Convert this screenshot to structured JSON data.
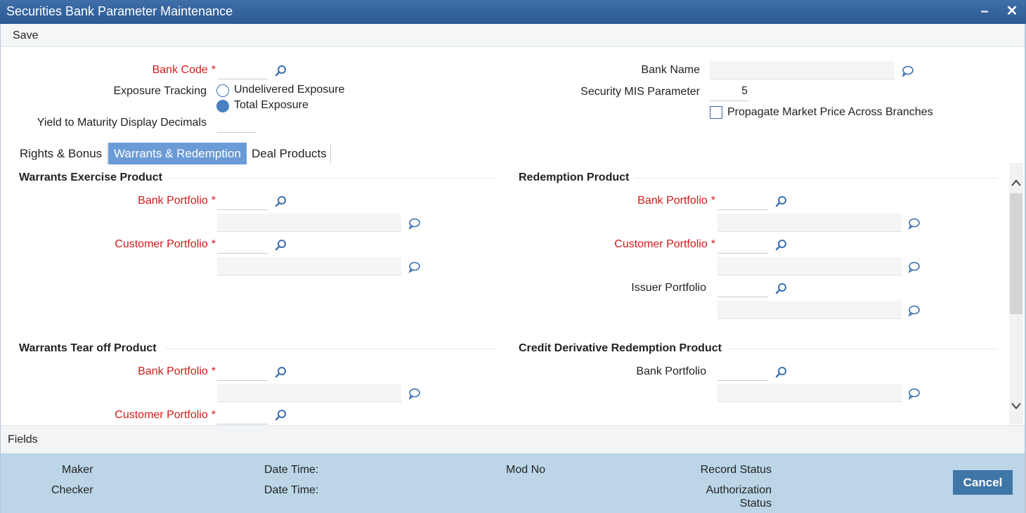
{
  "window": {
    "title": "Securities Bank Parameter Maintenance",
    "minimize_label": "–",
    "close_label": "✕"
  },
  "toolbar": {
    "save_label": "Save"
  },
  "header": {
    "bank_code_label": "Bank Code",
    "required_mark": "*",
    "bank_code_value": "",
    "exposure_tracking_label": "Exposure Tracking",
    "exposure_options": [
      "Undelivered Exposure",
      "Total Exposure"
    ],
    "exposure_selected": "Total Exposure",
    "ytm_label": "Yield to Maturity Display Decimals",
    "ytm_value": "",
    "bank_name_label": "Bank Name",
    "bank_name_value": "",
    "security_mis_label": "Security MIS Parameter",
    "security_mis_value": "5",
    "propagate_label": "Propagate Market Price Across Branches",
    "propagate_checked": false
  },
  "tabs": [
    "Rights & Bonus",
    "Warrants & Redemption",
    "Deal Products"
  ],
  "active_tab": "Warrants & Redemption",
  "sections": {
    "warrants_exercise": {
      "title": "Warrants Exercise Product",
      "bank_portfolio_label": "Bank Portfolio",
      "customer_portfolio_label": "Customer Portfolio"
    },
    "redemption": {
      "title": "Redemption Product",
      "bank_portfolio_label": "Bank Portfolio",
      "customer_portfolio_label": "Customer Portfolio",
      "issuer_portfolio_label": "Issuer Portfolio"
    },
    "warrants_tear_off": {
      "title": "Warrants Tear off Product",
      "bank_portfolio_label": "Bank Portfolio",
      "customer_portfolio_label": "Customer Portfolio"
    },
    "credit_derivative": {
      "title": "Credit Derivative Redemption Product",
      "bank_portfolio_label": "Bank Portfolio"
    }
  },
  "fields_bar": {
    "label": "Fields"
  },
  "footer": {
    "maker_label": "Maker",
    "checker_label": "Checker",
    "date_time_label": "Date Time:",
    "mod_no_label": "Mod No",
    "record_status_label": "Record Status",
    "authorization_label": "Authorization",
    "status_label": "Status",
    "cancel_label": "Cancel"
  },
  "colors": {
    "title_bar": "#2f5f9a",
    "required": "#d11a1a",
    "active_tab": "#6b9bd6",
    "footer": "#bcd6e8",
    "cancel_button": "#3e76a8"
  },
  "icons": {
    "lookup": "search-icon",
    "description": "speech-bubble-icon"
  }
}
